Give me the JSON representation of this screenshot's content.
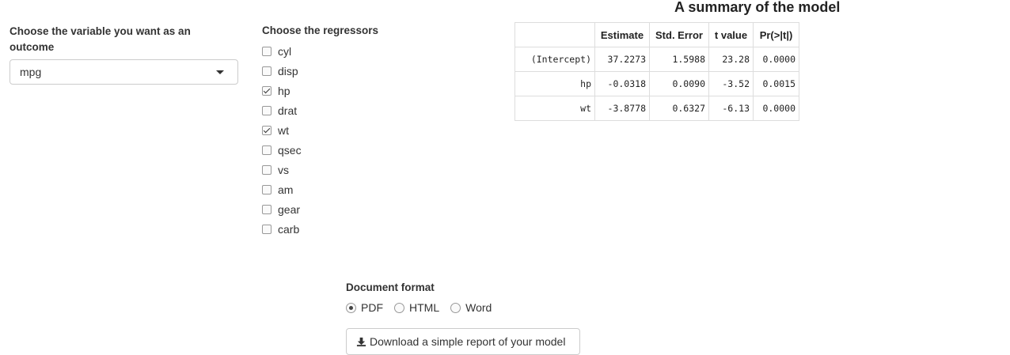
{
  "outcome": {
    "label": "Choose the variable you want as an outcome",
    "selected": "mpg"
  },
  "regressors": {
    "label": "Choose the regressors",
    "items": [
      {
        "label": "cyl",
        "checked": false
      },
      {
        "label": "disp",
        "checked": false
      },
      {
        "label": "hp",
        "checked": true
      },
      {
        "label": "drat",
        "checked": false
      },
      {
        "label": "wt",
        "checked": true
      },
      {
        "label": "qsec",
        "checked": false
      },
      {
        "label": "vs",
        "checked": false
      },
      {
        "label": "am",
        "checked": false
      },
      {
        "label": "gear",
        "checked": false
      },
      {
        "label": "carb",
        "checked": false
      }
    ]
  },
  "summary": {
    "title": "A summary of the model",
    "headers": [
      "Estimate",
      "Std. Error",
      "t value",
      "Pr(>|t|)"
    ],
    "rows": [
      {
        "name": "(Intercept)",
        "values": [
          "37.2273",
          "1.5988",
          "23.28",
          "0.0000"
        ]
      },
      {
        "name": "hp",
        "values": [
          "-0.0318",
          "0.0090",
          "-3.52",
          "0.0015"
        ]
      },
      {
        "name": "wt",
        "values": [
          "-3.8778",
          "0.6327",
          "-6.13",
          "0.0000"
        ]
      }
    ]
  },
  "format": {
    "label": "Document format",
    "options": [
      {
        "label": "PDF",
        "selected": true
      },
      {
        "label": "HTML",
        "selected": false
      },
      {
        "label": "Word",
        "selected": false
      }
    ]
  },
  "download": {
    "label": "Download a simple report of your model",
    "icon": "download-icon"
  }
}
